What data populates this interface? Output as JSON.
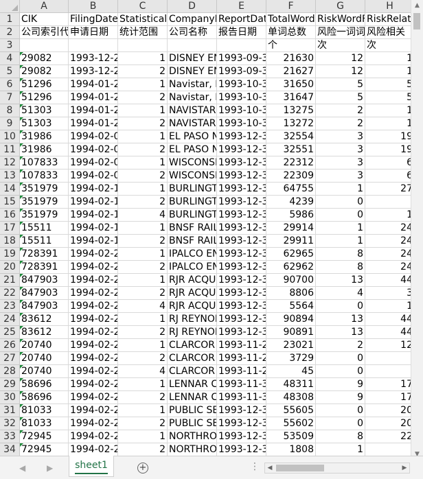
{
  "columns": [
    "A",
    "B",
    "C",
    "D",
    "E",
    "F",
    "G",
    "H"
  ],
  "header_row": [
    "CIK",
    "FilingDate",
    "StatisticalS",
    "CompanyN",
    "ReportDat",
    "TotalWord",
    "RiskWordF",
    "RiskRelat"
  ],
  "header_row_cn": [
    "公司索引代",
    "申请日期",
    "统计范围",
    "公司名称",
    "报告日期",
    "单词总数",
    "风险一词词",
    "风险相关"
  ],
  "header_row3": [
    "",
    "",
    "",
    "",
    "",
    "个",
    "次",
    "次"
  ],
  "rows": [
    {
      "n": "4",
      "a": "29082",
      "b": "1993-12-2",
      "c": "1",
      "d": "DISNEY EN",
      "e": "1993-09-3",
      "f": "21630",
      "g": "12",
      "h": "1"
    },
    {
      "n": "5",
      "a": "29082",
      "b": "1993-12-2",
      "c": "2",
      "d": "DISNEY EN",
      "e": "1993-09-3",
      "f": "21627",
      "g": "12",
      "h": "1"
    },
    {
      "n": "6",
      "a": "51296",
      "b": "1994-01-2",
      "c": "1",
      "d": "Navistar, Ir",
      "e": "1993-10-3",
      "f": "31650",
      "g": "5",
      "h": "5"
    },
    {
      "n": "7",
      "a": "51296",
      "b": "1994-01-2",
      "c": "2",
      "d": "Navistar, Ir",
      "e": "1993-10-3",
      "f": "31647",
      "g": "5",
      "h": "5"
    },
    {
      "n": "8",
      "a": "51303",
      "b": "1994-01-2",
      "c": "1",
      "d": "NAVISTAR",
      "e": "1993-10-3",
      "f": "13275",
      "g": "2",
      "h": "1"
    },
    {
      "n": "9",
      "a": "51303",
      "b": "1994-01-2",
      "c": "2",
      "d": "NAVISTAR",
      "e": "1993-10-3",
      "f": "13272",
      "g": "2",
      "h": "1"
    },
    {
      "n": "10",
      "a": "31986",
      "b": "1994-02-0",
      "c": "1",
      "d": "EL PASO N",
      "e": "1993-12-3",
      "f": "32554",
      "g": "3",
      "h": "19"
    },
    {
      "n": "11",
      "a": "31986",
      "b": "1994-02-0",
      "c": "2",
      "d": "EL PASO N",
      "e": "1993-12-3",
      "f": "32551",
      "g": "3",
      "h": "19"
    },
    {
      "n": "12",
      "a": "107833",
      "b": "1994-02-0",
      "c": "1",
      "d": "WISCONSI",
      "e": "1993-12-3",
      "f": "22312",
      "g": "3",
      "h": "6"
    },
    {
      "n": "13",
      "a": "107833",
      "b": "1994-02-0",
      "c": "2",
      "d": "WISCONSI",
      "e": "1993-12-3",
      "f": "22309",
      "g": "3",
      "h": "6"
    },
    {
      "n": "14",
      "a": "351979",
      "b": "1994-02-1",
      "c": "1",
      "d": "BURLINGT",
      "e": "1993-12-3",
      "f": "64755",
      "g": "1",
      "h": "27"
    },
    {
      "n": "15",
      "a": "351979",
      "b": "1994-02-1",
      "c": "2",
      "d": "BURLINGT",
      "e": "1993-12-3",
      "f": "4239",
      "g": "0",
      "h": ""
    },
    {
      "n": "16",
      "a": "351979",
      "b": "1994-02-1",
      "c": "4",
      "d": "BURLINGT",
      "e": "1993-12-3",
      "f": "5986",
      "g": "0",
      "h": "1"
    },
    {
      "n": "17",
      "a": "15511",
      "b": "1994-02-1",
      "c": "1",
      "d": "BNSF RAIL",
      "e": "1993-12-3",
      "f": "29914",
      "g": "1",
      "h": "24"
    },
    {
      "n": "18",
      "a": "15511",
      "b": "1994-02-1",
      "c": "2",
      "d": "BNSF RAIL",
      "e": "1993-12-3",
      "f": "29911",
      "g": "1",
      "h": "24"
    },
    {
      "n": "19",
      "a": "728391",
      "b": "1994-02-2",
      "c": "1",
      "d": "IPALCO EN",
      "e": "1993-12-3",
      "f": "62965",
      "g": "8",
      "h": "24"
    },
    {
      "n": "20",
      "a": "728391",
      "b": "1994-02-2",
      "c": "2",
      "d": "IPALCO EN",
      "e": "1993-12-3",
      "f": "62962",
      "g": "8",
      "h": "24"
    },
    {
      "n": "21",
      "a": "847903",
      "b": "1994-02-2",
      "c": "1",
      "d": "RJR ACQU",
      "e": "1993-12-3",
      "f": "90700",
      "g": "13",
      "h": "44"
    },
    {
      "n": "22",
      "a": "847903",
      "b": "1994-02-2",
      "c": "2",
      "d": "RJR ACQU",
      "e": "1993-12-3",
      "f": "8806",
      "g": "4",
      "h": "3"
    },
    {
      "n": "23",
      "a": "847903",
      "b": "1994-02-2",
      "c": "4",
      "d": "RJR ACQU",
      "e": "1993-12-3",
      "f": "5564",
      "g": "0",
      "h": "1"
    },
    {
      "n": "24",
      "a": "83612",
      "b": "1994-02-2",
      "c": "1",
      "d": "RJ REYNOL",
      "e": "1993-12-3",
      "f": "90894",
      "g": "13",
      "h": "44"
    },
    {
      "n": "25",
      "a": "83612",
      "b": "1994-02-2",
      "c": "2",
      "d": "RJ REYNOL",
      "e": "1993-12-3",
      "f": "90891",
      "g": "13",
      "h": "44"
    },
    {
      "n": "26",
      "a": "20740",
      "b": "1994-02-2",
      "c": "1",
      "d": "CLARCOR",
      "e": "1993-11-2",
      "f": "23021",
      "g": "2",
      "h": "12"
    },
    {
      "n": "27",
      "a": "20740",
      "b": "1994-02-2",
      "c": "2",
      "d": "CLARCOR",
      "e": "1993-11-2",
      "f": "3729",
      "g": "0",
      "h": ""
    },
    {
      "n": "28",
      "a": "20740",
      "b": "1994-02-2",
      "c": "4",
      "d": "CLARCOR",
      "e": "1993-11-2",
      "f": "45",
      "g": "0",
      "h": ""
    },
    {
      "n": "29",
      "a": "58696",
      "b": "1994-02-2",
      "c": "1",
      "d": "LENNAR C",
      "e": "1993-11-3",
      "f": "48311",
      "g": "9",
      "h": "17"
    },
    {
      "n": "30",
      "a": "58696",
      "b": "1994-02-2",
      "c": "2",
      "d": "LENNAR C",
      "e": "1993-11-3",
      "f": "48308",
      "g": "9",
      "h": "17"
    },
    {
      "n": "31",
      "a": "81033",
      "b": "1994-02-2",
      "c": "1",
      "d": "PUBLIC SEI",
      "e": "1993-12-3",
      "f": "55605",
      "g": "0",
      "h": "20"
    },
    {
      "n": "32",
      "a": "81033",
      "b": "1994-02-2",
      "c": "2",
      "d": "PUBLIC SEI",
      "e": "1993-12-3",
      "f": "55602",
      "g": "0",
      "h": "20"
    },
    {
      "n": "33",
      "a": "72945",
      "b": "1994-02-2",
      "c": "1",
      "d": "NORTHRO",
      "e": "1993-12-3",
      "f": "53509",
      "g": "8",
      "h": "22"
    },
    {
      "n": "34",
      "a": "72945",
      "b": "1994-02-2",
      "c": "2",
      "d": "NORTHRO",
      "e": "1993-12-3",
      "f": "1808",
      "g": "1",
      "h": ""
    }
  ],
  "tabs": {
    "active": "sheet1",
    "add_symbol": "+"
  },
  "colors": {
    "header_bg": "#e6e6e6",
    "grid": "#d9d9d9",
    "tab_accent": "#217346",
    "error_marker": "#1e8a3a"
  }
}
